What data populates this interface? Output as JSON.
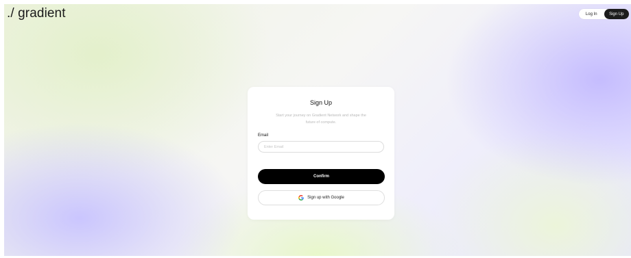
{
  "header": {
    "logo_text": "./ gradient",
    "login_label": "Log In",
    "signup_label": "Sign Up"
  },
  "card": {
    "title": "Sign Up",
    "subtitle_line1": "Start your journey on Gradient Network and shape the",
    "subtitle_line2": "future of compute.",
    "email_label": "Email",
    "email_placeholder": "Enter Email",
    "confirm_label": "Confirm",
    "google_label": "Sign up with Google"
  },
  "icons": {
    "google": "google-icon"
  },
  "colors": {
    "primary_button": "#000000",
    "active_toggle": "#1c1c1c",
    "subtitle_text": "#b9b9b9"
  }
}
